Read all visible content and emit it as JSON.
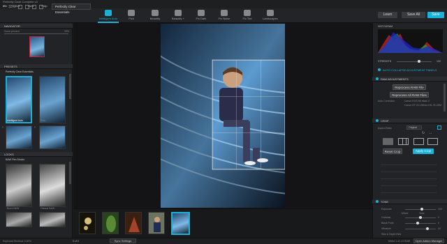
{
  "app": {
    "title": "Perfectly Clear Complete v3"
  },
  "menu": [
    "File",
    "Edit",
    "View",
    "Help"
  ],
  "toolbar": {
    "zoom": "33%",
    "preset_select": "Perfectly Clear Essentials",
    "tools": [
      {
        "label": "Intelligent Auto",
        "active": true
      },
      {
        "label": "Pick"
      },
      {
        "label": "Beautify"
      },
      {
        "label": "Beautify +"
      },
      {
        "label": "Fix Dark"
      },
      {
        "label": "Fix Noise"
      },
      {
        "label": "Fix Tint"
      },
      {
        "label": "Landscapes"
      }
    ],
    "learn": "Learn",
    "save_all": "Save All",
    "save": "Save"
  },
  "left": {
    "navigator": "NAVIGATOR",
    "zoom_label": "Zoom percent",
    "zoom_value": "33%",
    "presets": "PRESETS",
    "preset_group": "Perfectly Clear Essentials",
    "preset_items": [
      "Intelligent Auto",
      "Pick",
      "",
      ""
    ],
    "looks": "LOOKS",
    "looks_group": "B&W Film Stocks",
    "looks_items": [
      "Burnt B&W",
      "Classic B&W",
      "",
      ""
    ],
    "status_left": "Keyboard Shortcut: 0.61%"
  },
  "filmstrip": {
    "pager": "5 of 5",
    "sync": "Sync Settings"
  },
  "right": {
    "histogram": "HISTOGRAM",
    "strength": "STRENGTH",
    "strength_value": "100",
    "auto_collapse": "AUTO COLLAPSE ADJUSTMENT PANELS",
    "raw": "RAW ADJUSTMENTS",
    "reprocess": "Reprocess RAW File",
    "reprocess_all": "Reprocess All RAW Files",
    "auto_correction": "Auto Correction",
    "camera_line1": "Canon EOS 5D Mark II",
    "camera_line2": "Canon EF 24-105mm f/4L IS USM",
    "crop": "CROP",
    "aspect": "Aspect Ratio",
    "aspect_value": "Original",
    "reset_crop": "Reset Crop",
    "apply_crop": "Apply Crop",
    "tone": "TONE",
    "exposure": "Exposure",
    "contrast": "Contrast",
    "black_point": "Black Point",
    "vibrance": "Vibrance",
    "skin": "Skin & Depth Bias",
    "opt_label": "Mixed",
    "opt_label2": "Tone",
    "status_right": "Mixed 1 of 1.0 RAW",
    "open_addons": "Open Addon Manager",
    "ticks": [
      "100",
      "0",
      "0",
      "44"
    ]
  },
  "colors": {
    "accent": "#1ab2d8",
    "bg": "#1b1c1e",
    "panel": "#222326"
  }
}
